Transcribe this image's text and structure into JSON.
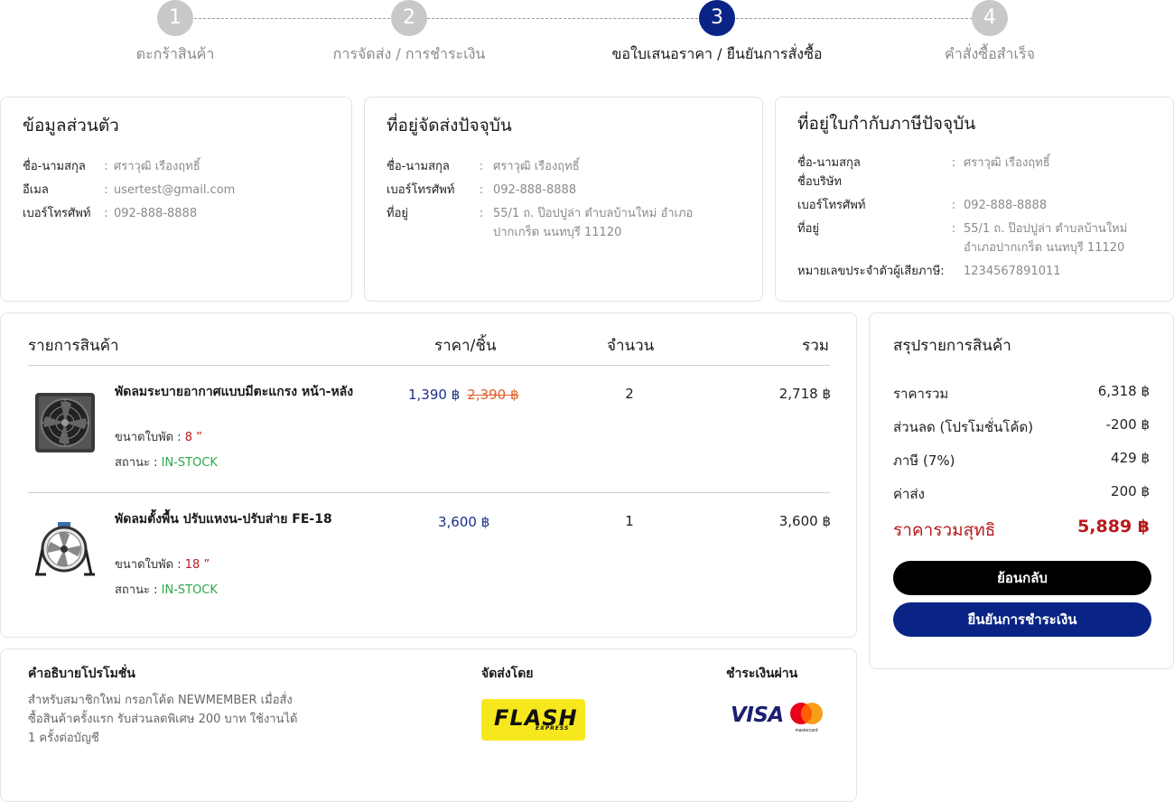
{
  "stepper": {
    "steps": [
      {
        "num": "1",
        "label": "ตะกร้าสินค้า"
      },
      {
        "num": "2",
        "label": "การจัดส่ง / การชำระเงิน"
      },
      {
        "num": "3",
        "label": "ขอใบเสนอราคา / ยืนยันการสั่งซื้อ"
      },
      {
        "num": "4",
        "label": "คำสั่งซื้อสำเร็จ"
      }
    ],
    "active_step": 3
  },
  "personal": {
    "title": "ข้อมูลส่วนตัว",
    "name_label": "ชื่อ-นามสกุล",
    "name": "ศราวุฒิ เรืองฤทธิ์",
    "email_label": "อีเมล",
    "email": "usertest@gmail.com",
    "phone_label": "เบอร์โทรศัพท์",
    "phone": "092-888-8888"
  },
  "shipping_address": {
    "title": "ที่อยู่จัดส่งปัจจุบัน",
    "name_label": "ชื่อ-นามสกุล",
    "name": "ศราวุฒิ เรืองฤทธิ์",
    "phone_label": "เบอร์โทรศัพท์",
    "phone": "092-888-8888",
    "address_label": "ที่อยู่",
    "address": "55/1 ถ. ป๊อปปูล่า ตำบลบ้านใหม่ อำเภอปากเกร็ด นนทบุรี 11120"
  },
  "tax_address": {
    "title": "ที่อยู่ใบกำกับภาษีปัจจุบัน",
    "name_label": "ชื่อ-นามสกุล",
    "company_label": "ชื่อบริษัท",
    "name": "ศราวุฒิ เรืองฤทธิ์",
    "phone_label": "เบอร์โทรศัพท์",
    "phone": "092-888-8888",
    "address_label": "ที่อยู่",
    "address": "55/1 ถ. ป๊อปปูล่า ตำบลบ้านใหม่ อำเภอปากเกร็ด นนทบุรี 11120",
    "taxid_label": "หมายเลขประจำตัวผู้เสียภาษี:",
    "taxid": "1234567891011"
  },
  "separator": ":",
  "products": {
    "headers": {
      "item": "รายการสินค้า",
      "price": "ราคา/ชิ้น",
      "qty": "จำนวน",
      "total": "รวม"
    },
    "items": [
      {
        "name": "พัดลมระบายอากาศแบบมีตะแกรง หน้า-หลัง",
        "blade_label": "ขนาดใบพัด :",
        "blade": "8 ”",
        "status_label": "สถานะ :",
        "status": "IN-STOCK",
        "price": "1,390 ฿",
        "old_price": "2,390 ฿",
        "qty": "2",
        "total": "2,718 ฿"
      },
      {
        "name": "พัดลมตั้งพื้น ปรับแหงน-ปรับส่าย FE-18",
        "blade_label": "ขนาดใบพัด :",
        "blade": "18 ”",
        "status_label": "สถานะ :",
        "status": "IN-STOCK",
        "price": "3,600 ฿",
        "qty": "1",
        "total": "3,600 ฿"
      }
    ]
  },
  "summary": {
    "title": "สรุปรายการสินค้า",
    "rows": [
      {
        "label": "ราคารวม",
        "value": "6,318 ฿"
      },
      {
        "label": "ส่วนลด (โปรโมชั่นโค้ด)",
        "value": "-200 ฿"
      },
      {
        "label": "ภาษี (7%)",
        "value": "429 ฿"
      },
      {
        "label": "ค่าส่ง",
        "value": "200 ฿"
      }
    ],
    "net_label": "ราคารวมสุทธิ",
    "net_value": "5,889 ฿",
    "back_button": "ย้อนกลับ",
    "confirm_button": "ยืนยันการชำระเงิน"
  },
  "promo": {
    "title": "คำอธิบายโปรโมชั่น",
    "text": "สำหรับสมาชิกใหม่ กรอกโค้ด NEWMEMBER เมื่อสั่งซื้อสินค้าครั้งแรก รับส่วนลดพิเศษ 200 บาท ใช้งานได้ 1 ครั้งต่อบัญชี"
  },
  "shipping": {
    "title": "จัดส่งโดย",
    "logo_text": "FLASH",
    "logo_sub": "EXPRESS"
  },
  "payment": {
    "title": "ชำระเงินผ่าน",
    "visa_text": "VISA",
    "mastercard_text": "mastercard"
  },
  "colors": {
    "primary": "#0a2486",
    "net_red": "#b81a1a",
    "instock_green": "#2aa84a",
    "old_price": "#e06030"
  }
}
